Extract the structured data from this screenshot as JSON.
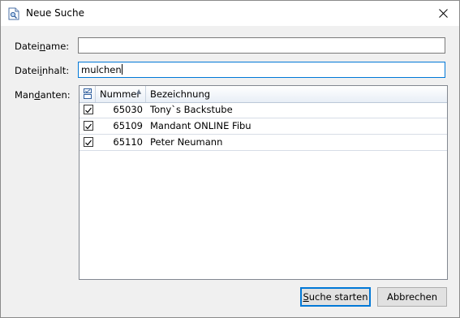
{
  "window": {
    "title": "Neue Suche",
    "icon": "search-document-icon",
    "close_icon": "close-icon"
  },
  "form": {
    "dateiname": {
      "label_pre": "Datei",
      "label_accel": "n",
      "label_post": "ame:",
      "value": ""
    },
    "dateiinhalt": {
      "label_pre": "Datei",
      "label_accel": "i",
      "label_post": "nhalt:",
      "value": "mulchen"
    },
    "mandanten": {
      "label_pre": "Man",
      "label_accel": "d",
      "label_post": "anten:"
    }
  },
  "grid": {
    "columns": {
      "select_icon": "select-all-checkbox-icon",
      "nummer": "Nummer",
      "bezeichnung": "Bezeichnung"
    },
    "rows": [
      {
        "checked": true,
        "nummer": "65030",
        "bezeichnung": "Tony`s Backstube"
      },
      {
        "checked": true,
        "nummer": "65109",
        "bezeichnung": "Mandant ONLINE Fibu"
      },
      {
        "checked": true,
        "nummer": "65110",
        "bezeichnung": "Peter Neumann"
      }
    ]
  },
  "buttons": {
    "start": {
      "accel": "S",
      "rest": "uche starten"
    },
    "cancel": "Abbrechen"
  },
  "colors": {
    "focus_border": "#0078d7",
    "header_grad_bottom": "#e8eef6"
  }
}
